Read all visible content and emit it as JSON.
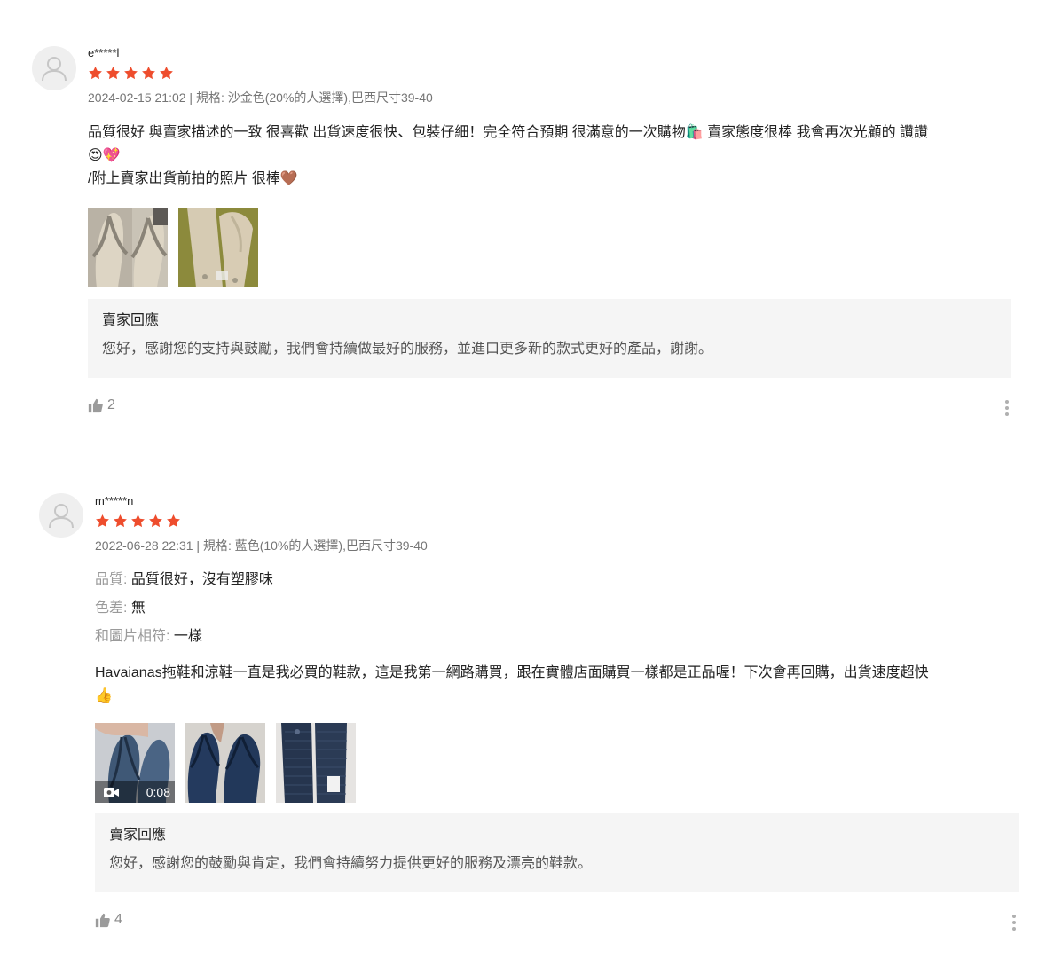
{
  "reviews": [
    {
      "username": "e*****l",
      "rating": 5,
      "meta": "2024-02-15 21:02 | 規格: 沙金色(20%的人選擇),巴西尺寸39-40",
      "content": {
        "line1": "品質很好 與賣家描述的一致 很喜歡 出貨速度很快、包裝仔細！完全符合預期 很滿意的一次購物",
        "line1_emoji": "🛍️",
        "line1_rest": " 賣家態度很棒 我會再次光顧的 讚讚",
        "line2_emojis": [
          "😍",
          "💖"
        ],
        "line3": "/附上賣家出貨前拍的照片 很棒",
        "line3_emoji": "🤎"
      },
      "images": [
        {
          "alt": "沙金色拖鞋照片1"
        },
        {
          "alt": "沙金色拖鞋照片2"
        }
      ],
      "seller_reply": {
        "title": "賣家回應",
        "text": "您好，感謝您的支持與鼓勵，我們會持續做最好的服務，並進口更多新的款式更好的產品，謝謝。"
      },
      "likes": "2"
    },
    {
      "username": "m*****n",
      "rating": 5,
      "meta": "2022-06-28 22:31 | 規格: 藍色(10%的人選擇),巴西尺寸39-40",
      "attributes": [
        {
          "key": "品質: ",
          "value": "品質很好，沒有塑膠味"
        },
        {
          "key": "色差: ",
          "value": "無"
        },
        {
          "key": "和圖片相符: ",
          "value": "一樣"
        }
      ],
      "content": {
        "line1": "Havaianas拖鞋和涼鞋一直是我必買的鞋款，這是我第一網路購買，跟在實體店面購買一樣都是正品喔！下次會再回購，出貨速度超快",
        "line2_emoji": "👍"
      },
      "video_duration": "0:08",
      "images": [
        {
          "alt": "藍色拖鞋影片"
        },
        {
          "alt": "藍色拖鞋照片1"
        },
        {
          "alt": "藍色拖鞋照片2"
        }
      ],
      "seller_reply": {
        "title": "賣家回應",
        "text": "您好，感謝您的鼓勵與肯定，我們會持續努力提供更好的服務及漂亮的鞋款。"
      },
      "likes": "4"
    }
  ],
  "colors": {
    "star": "#ee4d2d",
    "reply_bg": "#f5f5f5",
    "meta": "#757575"
  }
}
